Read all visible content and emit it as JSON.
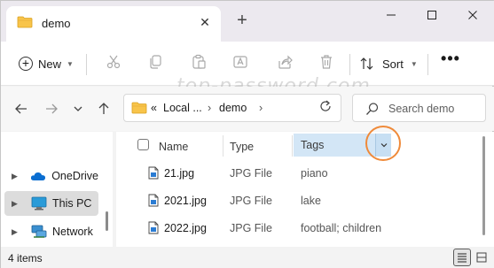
{
  "window": {
    "tab_title": "demo",
    "new_tab_symbol": "+",
    "close_tab_symbol": "✕"
  },
  "toolbar": {
    "new_label": "New",
    "sort_label": "Sort",
    "more_label": "•••",
    "icons": [
      "cut-icon",
      "copy-icon",
      "paste-icon",
      "rename-icon",
      "share-icon",
      "delete-icon"
    ]
  },
  "watermark": "top-password.com",
  "address": {
    "prefix": "«",
    "segments": [
      "Local ...",
      "demo"
    ],
    "separator": "›"
  },
  "search": {
    "placeholder": "Search demo"
  },
  "nav_pane": {
    "items": [
      {
        "label": "OneDrive",
        "icon": "onedrive-icon",
        "selected": false
      },
      {
        "label": "This PC",
        "icon": "this-pc-icon",
        "selected": true
      },
      {
        "label": "Network",
        "icon": "network-icon",
        "selected": false
      }
    ]
  },
  "columns": {
    "name": "Name",
    "type": "Type",
    "tags": "Tags"
  },
  "files": [
    {
      "name": "21.jpg",
      "type": "JPG File",
      "tags": "piano"
    },
    {
      "name": "2021.jpg",
      "type": "JPG File",
      "tags": "lake"
    },
    {
      "name": "2022.jpg",
      "type": "JPG File",
      "tags": "football; children"
    }
  ],
  "status": {
    "item_count": "4 items"
  },
  "colors": {
    "accent": "#0067c0",
    "highlight_circle": "#ef8a3a",
    "folder": "#f8c44a",
    "selected_header": "#d3e6f6"
  }
}
